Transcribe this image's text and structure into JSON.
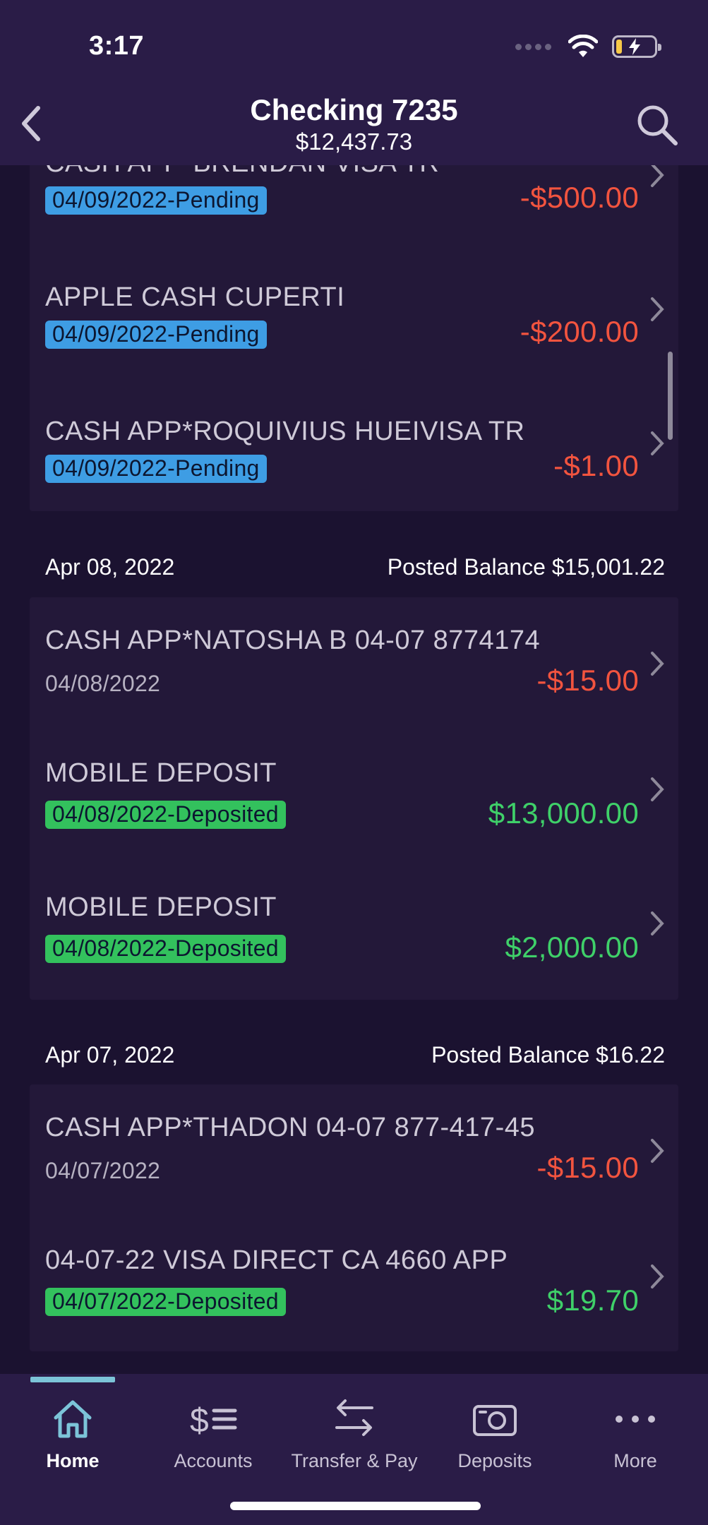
{
  "status_bar": {
    "time": "3:17"
  },
  "header": {
    "title": "Checking 7235",
    "balance": "$12,437.73"
  },
  "groups": [
    {
      "transactions": [
        {
          "name": "CASH APP*BRENDAN VISA TR",
          "date": "04/09/2022-Pending",
          "status": "pending",
          "amount": "-$500.00"
        },
        {
          "name": "APPLE CASH CUPERTI",
          "date": "04/09/2022-Pending",
          "status": "pending",
          "amount": "-$200.00"
        },
        {
          "name": "CASH APP*ROQUIVIUS HUEIVISA TR",
          "date": "04/09/2022-Pending",
          "status": "pending",
          "amount": "-$1.00"
        }
      ]
    },
    {
      "date": "Apr 08, 2022",
      "posted_balance": "Posted Balance $15,001.22",
      "transactions": [
        {
          "name": "CASH APP*NATOSHA B 04-07 8774174",
          "date": "04/08/2022",
          "status": "posted",
          "amount": "-$15.00"
        },
        {
          "name": "MOBILE DEPOSIT",
          "date": "04/08/2022-Deposited",
          "status": "deposited",
          "amount": "$13,000.00"
        },
        {
          "name": "MOBILE DEPOSIT",
          "date": "04/08/2022-Deposited",
          "status": "deposited",
          "amount": "$2,000.00"
        }
      ]
    },
    {
      "date": "Apr 07, 2022",
      "posted_balance": "Posted Balance $16.22",
      "transactions": [
        {
          "name": "CASH APP*THADON 04-07 877-417-45",
          "date": "04/07/2022",
          "status": "posted",
          "amount": "-$15.00"
        },
        {
          "name": "04-07-22 VISA DIRECT CA 4660 APP",
          "date": "04/07/2022-Deposited",
          "status": "deposited",
          "amount": "$19.70"
        }
      ]
    }
  ],
  "tabbar": {
    "tabs": [
      {
        "label": "Home",
        "icon": "home-icon",
        "active": true
      },
      {
        "label": "Accounts",
        "icon": "accounts-icon"
      },
      {
        "label": "Transfer & Pay",
        "icon": "transfer-icon"
      },
      {
        "label": "Deposits",
        "icon": "camera-icon"
      },
      {
        "label": "More",
        "icon": "more-dots-icon"
      }
    ]
  },
  "colors": {
    "background": "#1c1330",
    "header": "#2a1c47",
    "card": "#231839",
    "negative": "#f2543f",
    "positive": "#3fd069",
    "pending_badge": "#3e9de4",
    "deposited_badge": "#33c15d"
  }
}
